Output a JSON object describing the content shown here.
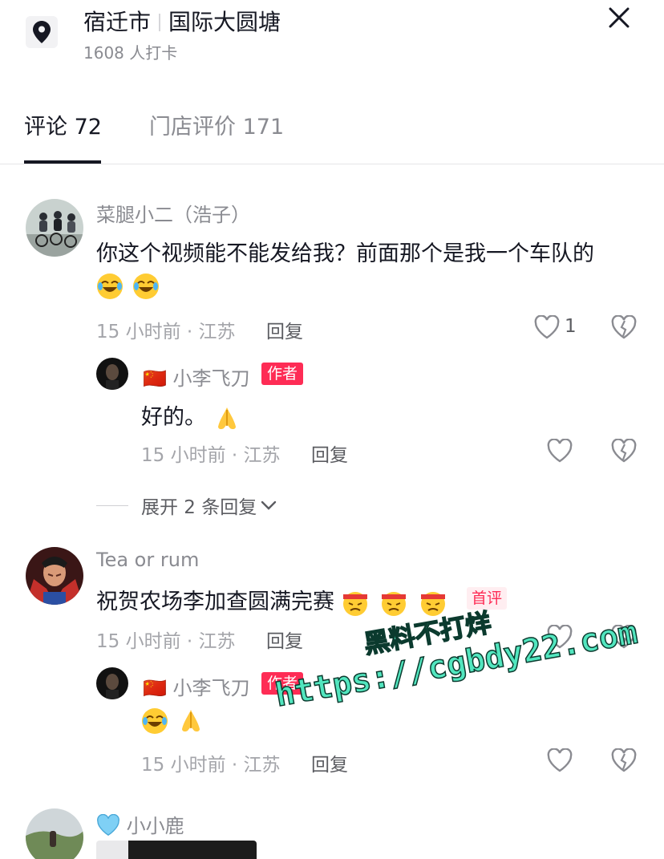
{
  "header": {
    "city": "宿迁市",
    "place": "国际大圆塘",
    "checkins": "1608 人打卡"
  },
  "tabs": [
    {
      "label": "评论 72",
      "active": true
    },
    {
      "label": "门店评价 171",
      "active": false
    }
  ],
  "comments": [
    {
      "name": "菜腿小二（浩子）",
      "text": "你这个视频能不能发给我？前面那个是我一个车队的",
      "emojis": [
        "laughing-crying",
        "laughing-crying"
      ],
      "meta": "15 小时前 · 江苏",
      "reply_label": "回复",
      "likes": "1",
      "replies": [
        {
          "flag": "🇨🇳",
          "name": "小李飞刀",
          "tag": "作者",
          "text": "好的。",
          "emojis": [
            "praying-hands"
          ],
          "meta": "15 小时前 · 江苏",
          "reply_label": "回复"
        }
      ],
      "expand_label": "展开 2 条回复"
    },
    {
      "name": "Tea or rum",
      "text": "祝贺农场李加查圆满完赛",
      "emojis": [
        "angry-headband",
        "angry-headband",
        "angry-headband"
      ],
      "tag": "首评",
      "meta": "15 小时前 · 江苏",
      "reply_label": "回复",
      "replies": [
        {
          "flag": "🇨🇳",
          "name": "小李飞刀",
          "tag": "作者",
          "text": "",
          "emojis": [
            "laughing-crying",
            "praying-hands"
          ],
          "meta": "15 小时前 · 江苏",
          "reply_label": "回复"
        }
      ]
    },
    {
      "name": "小小鹿",
      "name_prefix_icon": "light-blue-heart"
    }
  ],
  "watermark": {
    "line1": "黑料不打烊",
    "line2": "https://cgbdy22.com"
  },
  "colors": {
    "accent": "#fe2c55",
    "text_primary": "#161823",
    "text_secondary": "#8a8b91",
    "watermark": "#52e6bf"
  }
}
